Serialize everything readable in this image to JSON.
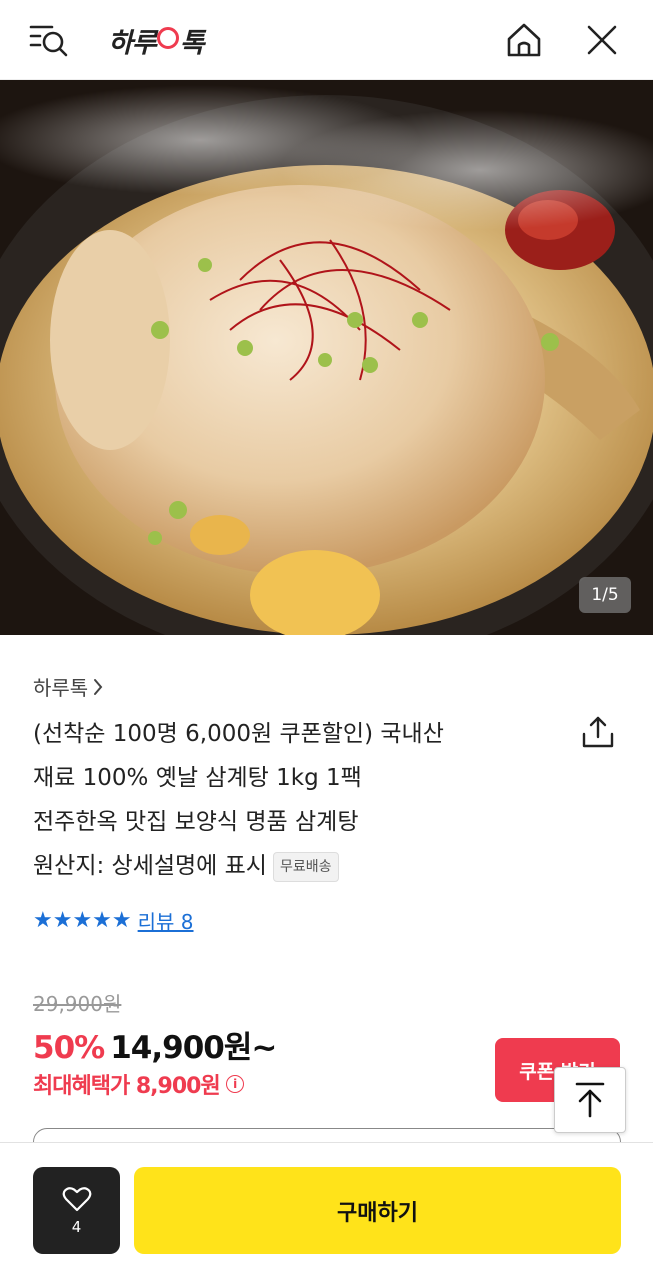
{
  "header": {
    "logo_text_left": "하루",
    "logo_text_right": "톡",
    "menu_search_icon": "menu-search-icon",
    "home_icon": "home-icon",
    "close_icon": "close-icon"
  },
  "gallery": {
    "pager": "1/5"
  },
  "product": {
    "brand": "하루톡",
    "brand_chevron": ">",
    "title_lines": [
      "(선착순 100명 6,000원 쿠폰할인) 국내산",
      "재료 100% 옛날 삼계탕 1kg 1팩",
      "전주한옥 맛집 보양식 명품 삼계탕",
      "원산지: 상세설명에 표시"
    ],
    "shipping_badge": "무료배송",
    "stars": "★★★★★",
    "review_link": "리뷰 8",
    "original_price": "29,900원",
    "discount_rate": "50%",
    "sale_price": "14,900원~",
    "max_benefit": "최대혜택가 8,900원",
    "info_icon_glyph": "i",
    "coupon_button": "쿠폰 받기"
  },
  "bottom_bar": {
    "like_count": "4",
    "buy_button": "구매하기"
  },
  "colors": {
    "accent_red": "#ef3b4f",
    "rating_blue": "#1b6fd6",
    "buy_yellow": "#ffe31a",
    "like_dark": "#222222"
  }
}
